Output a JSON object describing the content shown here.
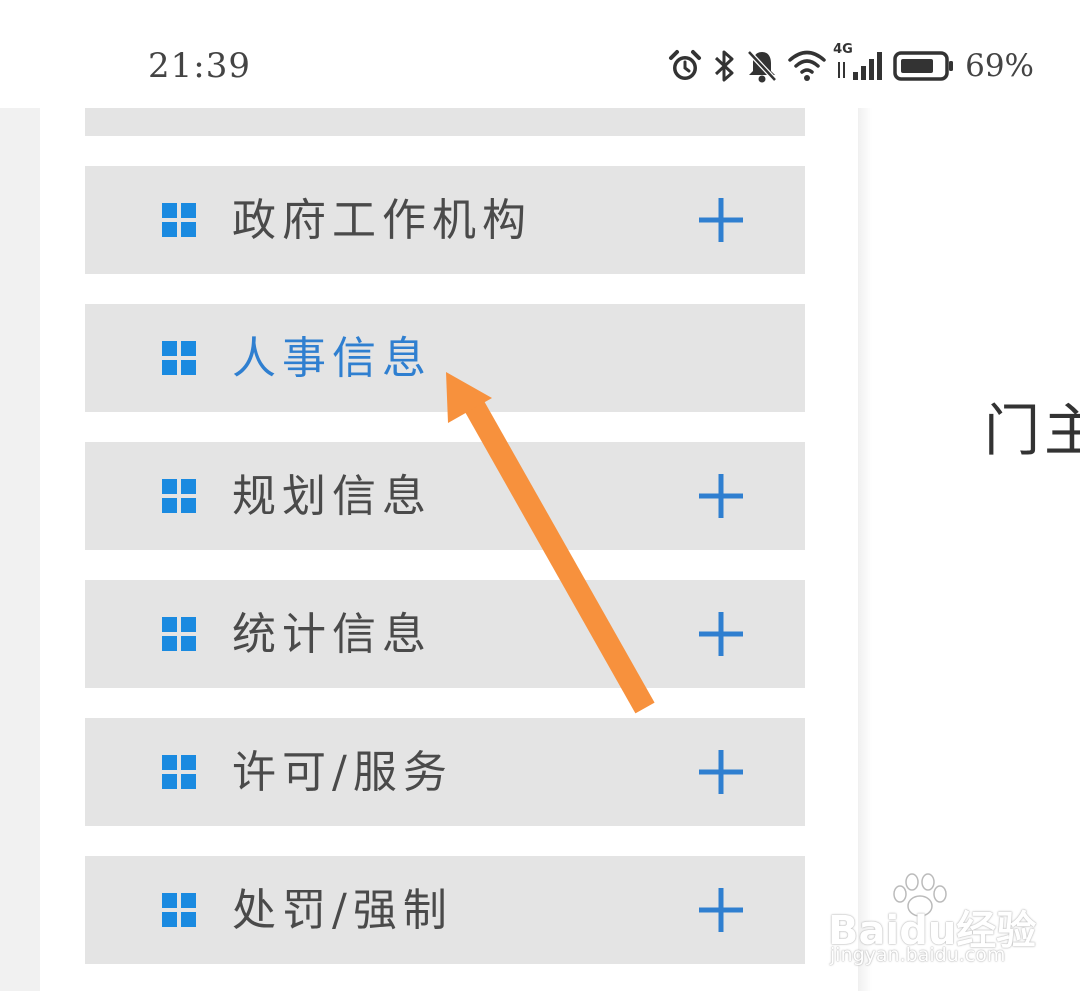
{
  "status_bar": {
    "time": "21:39",
    "battery_percent": "69%",
    "network_label": "4G",
    "icons": [
      "alarm-icon",
      "bluetooth-icon",
      "notifications-muted-icon",
      "wifi-icon",
      "cellular-signal-icon",
      "battery-icon"
    ],
    "battery_level": 0.69
  },
  "menu": {
    "items": [
      {
        "label": "政府工作机构",
        "icon": "grid-icon",
        "expandable": true,
        "active": false
      },
      {
        "label": "人事信息",
        "icon": "grid-icon",
        "expandable": false,
        "active": true
      },
      {
        "label": "规划信息",
        "icon": "grid-icon",
        "expandable": true,
        "active": false
      },
      {
        "label": "统计信息",
        "icon": "grid-icon",
        "expandable": true,
        "active": false
      },
      {
        "label": "许可/服务",
        "icon": "grid-icon",
        "expandable": true,
        "active": false
      },
      {
        "label": "处罚/强制",
        "icon": "grid-icon",
        "expandable": true,
        "active": false
      }
    ]
  },
  "content": {
    "partial_text": "门主"
  },
  "watermark": {
    "main": "Baidu经验",
    "sub": "jingyan.baidu.com"
  },
  "colors": {
    "accent_blue": "#2f7fd0",
    "icon_blue": "#1a8ae0",
    "item_bg": "#e4e4e4",
    "arrow_orange": "#f7913d"
  }
}
